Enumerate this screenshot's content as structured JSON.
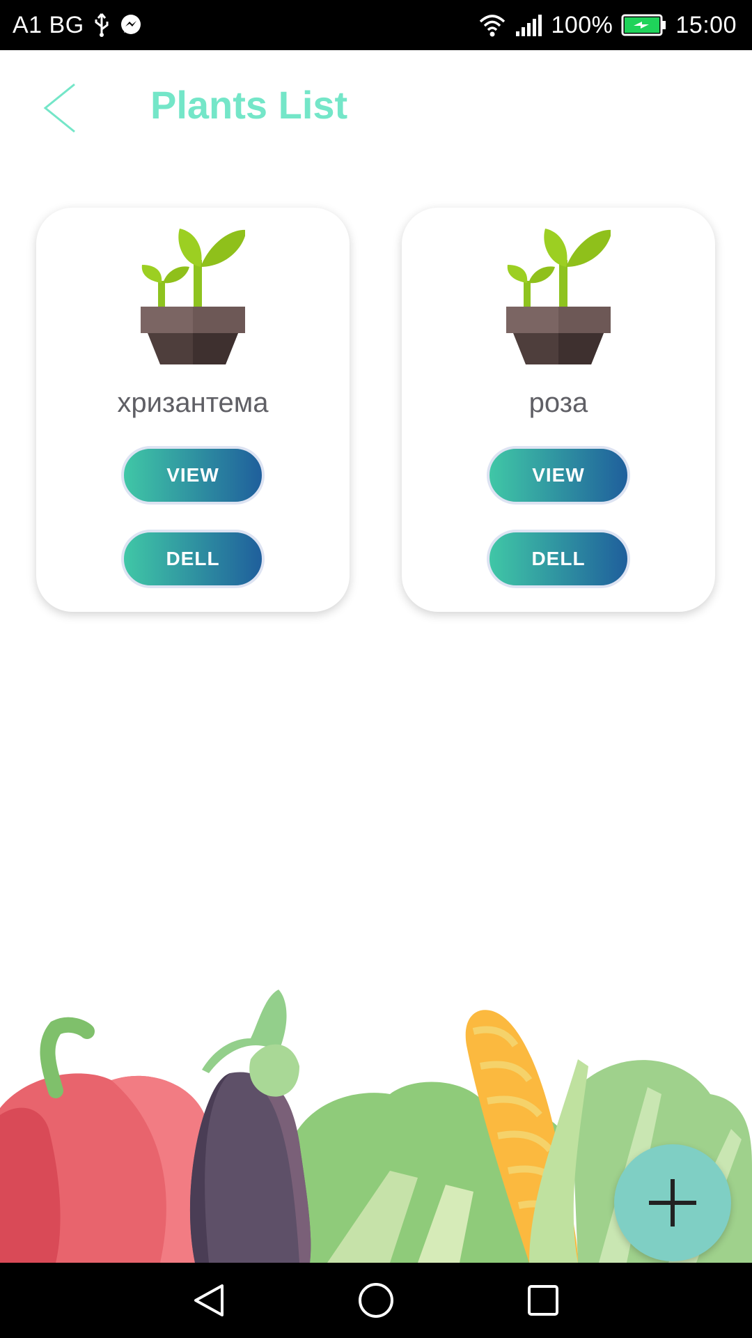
{
  "status_bar": {
    "carrier": "A1 BG",
    "battery": "100%",
    "time": "15:00",
    "icons": [
      "usb-icon",
      "messenger-icon",
      "wifi-icon",
      "signal-icon",
      "battery-charging-icon"
    ]
  },
  "header": {
    "title": "Plants List",
    "back_icon": "chevron-left-icon"
  },
  "plants": [
    {
      "name": "хризантема",
      "icon": "potted-plant-icon",
      "view_label": "VIEW",
      "delete_label": "DELL"
    },
    {
      "name": "роза",
      "icon": "potted-plant-icon",
      "view_label": "VIEW",
      "delete_label": "DELL"
    }
  ],
  "fab": {
    "icon": "plus-icon"
  },
  "nav_bar": {
    "icons": [
      "back-triangle-icon",
      "home-circle-icon",
      "recents-square-icon"
    ]
  },
  "colors": {
    "accent": "#74e6c8",
    "button_gradient_start": "#40c7a6",
    "button_gradient_end": "#1f5f9c",
    "fab": "#7fcfc4"
  }
}
